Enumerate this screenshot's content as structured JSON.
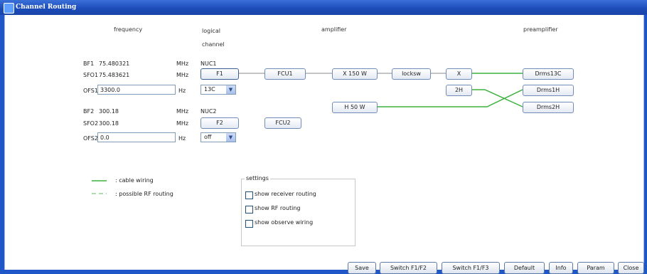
{
  "window": {
    "title": "Channel Routing"
  },
  "headers": {
    "frequency": "frequency",
    "logical_line1": "logical",
    "logical_line2": "channel",
    "amplifier": "amplifier",
    "preamplifier": "preamplifier"
  },
  "channel1": {
    "bf_label": "BF1",
    "bf_value": "75.480321",
    "bf_unit": "MHz",
    "nucleus": "NUC1",
    "sfo_label": "SFO1",
    "sfo_value": "75.483621",
    "sfo_unit": "MHz",
    "logical_button": "F1",
    "ofs_label": "OFS1",
    "ofs_value": "3300.0",
    "ofs_unit": "Hz",
    "nucleus_select": "13C"
  },
  "channel2": {
    "bf_label": "BF2",
    "bf_value": "300.18",
    "bf_unit": "MHz",
    "nucleus": "NUC2",
    "sfo_label": "SFO2",
    "sfo_value": "300.18",
    "sfo_unit": "MHz",
    "logical_button": "F2",
    "ofs_label": "OFS2",
    "ofs_value": "0.0",
    "ofs_unit": "Hz",
    "nucleus_select": "off"
  },
  "routing": {
    "fcu1": "FCU1",
    "fcu2": "FCU2",
    "amp_x150": "X 150 W",
    "locksw": "locksw",
    "switch_x": "X",
    "switch_2h": "2H",
    "amp_h50": "H 50 W",
    "preamp1": "Drms13C",
    "preamp2": "Drms1H",
    "preamp3": "Drms2H"
  },
  "legend": {
    "cable": ": cable wiring",
    "rf": ": possible RF routing"
  },
  "settings": {
    "title": "settings",
    "receiver": "show receiver routing",
    "rf_routing": "show RF routing",
    "observe": "show observe wiring"
  },
  "buttons": {
    "save": "Save",
    "switch12": "Switch F1/F2",
    "switch13": "Switch F1/F3",
    "default": "Default",
    "info": "Info",
    "param": "Param",
    "close": "Close"
  },
  "colors": {
    "wire_green": "#3cb13c",
    "wire_gray": "#8a8a8a",
    "title_blue": "#1f56c8"
  }
}
